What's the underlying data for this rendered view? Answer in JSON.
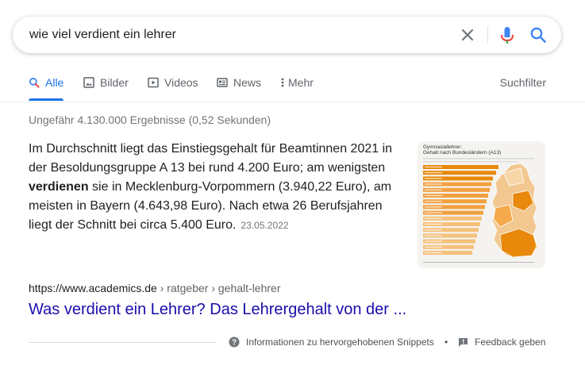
{
  "search": {
    "query": "wie viel verdient ein lehrer"
  },
  "tabs": [
    {
      "label": "Alle",
      "icon": "search-icon",
      "active": true
    },
    {
      "label": "Bilder",
      "icon": "image-icon",
      "active": false
    },
    {
      "label": "Videos",
      "icon": "video-icon",
      "active": false
    },
    {
      "label": "News",
      "icon": "news-icon",
      "active": false
    },
    {
      "label": "Mehr",
      "icon": "more-vertical-icon",
      "active": false
    }
  ],
  "search_tools_label": "Suchfilter",
  "result_stats": "Ungefähr 4.130.000 Ergebnisse (0,52 Sekunden)",
  "snippet": {
    "text_before": "Im Durchschnitt liegt das Einstiegsgehalt für Beamtinnen 2021 in der Besoldungsgruppe A 13 bei rund 4.200 Euro; am wenigsten ",
    "bold": "verdienen",
    "text_after": " sie in Mecklenburg-Vorpommern (3.940,22 Euro), am meisten in Bayern (4.643,98 Euro). Nach etwa 26 Berufsjahren liegt der Schnitt bei circa 5.400 Euro.",
    "date": "23.05.2022",
    "thumbnail": {
      "title_line1": "Gymnasiallehrer:",
      "title_line2": "Gehalt nach Bundesländern (A13)"
    }
  },
  "result": {
    "url_domain": "https://www.academics.de",
    "url_path": " › ratgeber › gehalt-lehrer",
    "title": "Was verdient ein Lehrer? Das Lehrergehalt von der ..."
  },
  "footer": {
    "info_label": "Informationen zu hervorgehobenen Snippets",
    "separator": "•",
    "feedback_label": "Feedback geben"
  },
  "colors": {
    "link_blue": "#1a0dab",
    "accent_blue": "#1a73e8",
    "mic_red": "#ea4335",
    "chart_orange": "#e8890c"
  }
}
